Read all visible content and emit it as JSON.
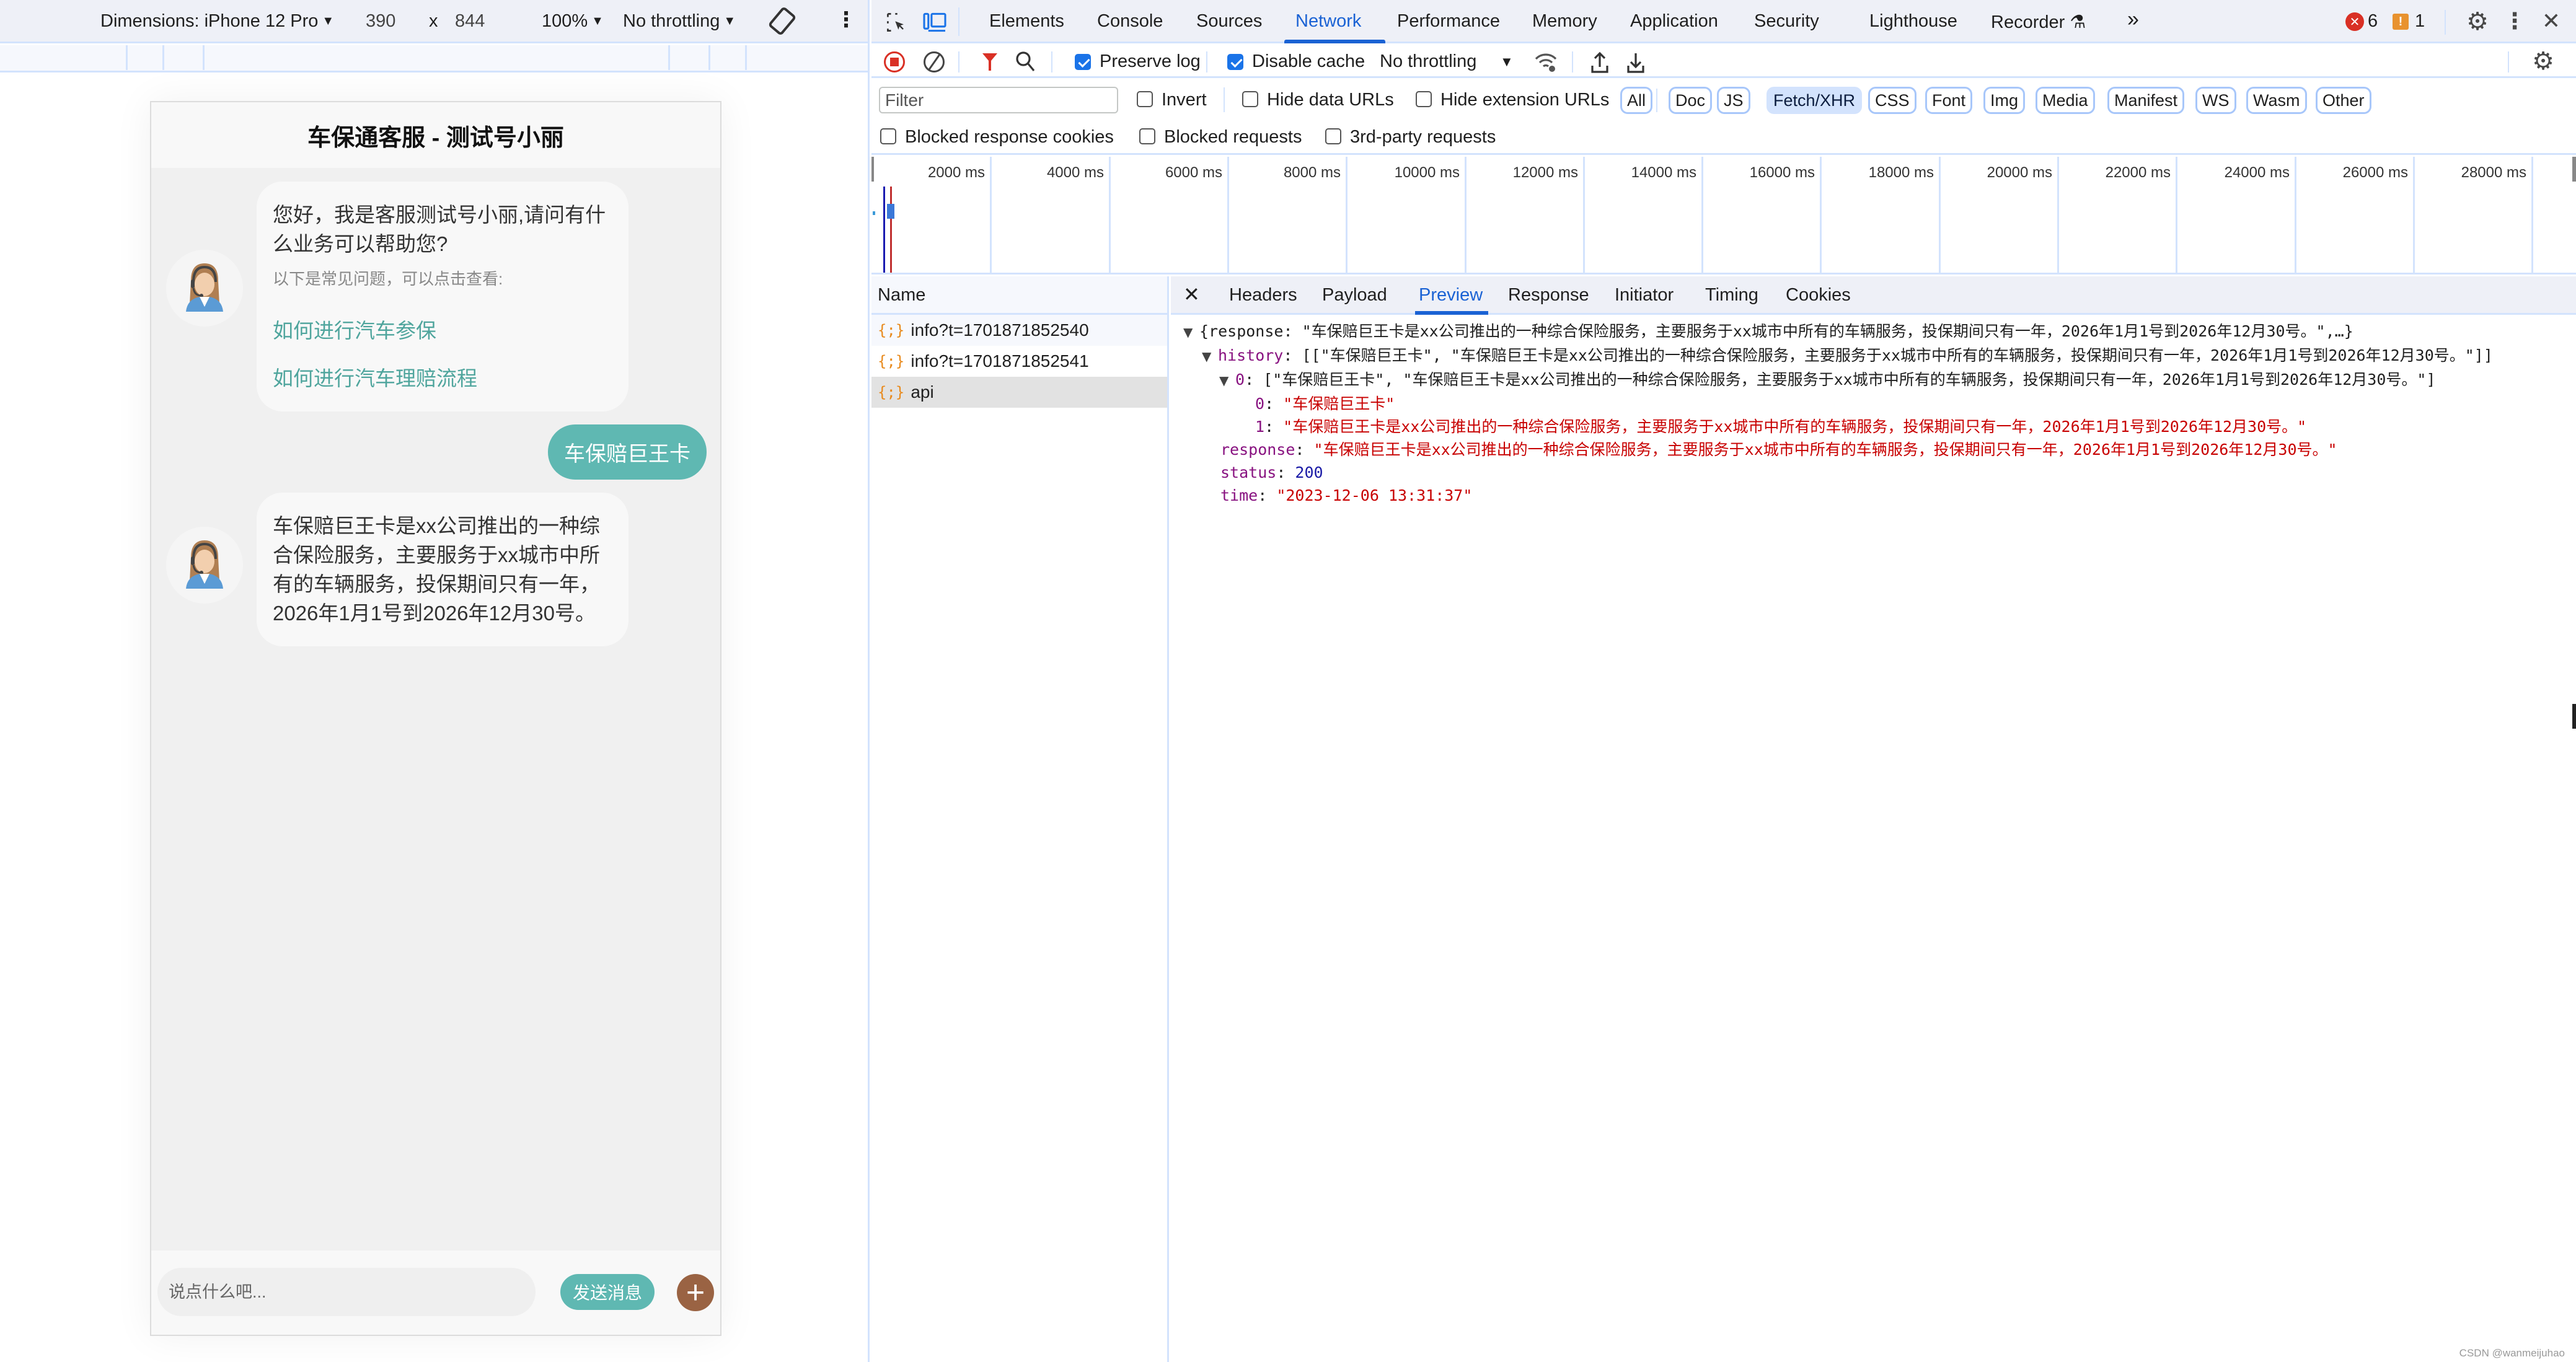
{
  "device_toolbar": {
    "dimensions_label": "Dimensions: iPhone 12 Pro",
    "width": "390",
    "times": "x",
    "height": "844",
    "zoom": "100%",
    "throttling": "No throttling"
  },
  "chat": {
    "title": "车保通客服 - 测试号小丽",
    "messages": [
      {
        "from": "agent",
        "text": "您好，我是客服测试号小丽,请问有什么业务可以帮助您?",
        "hint": "以下是常见问题，可以点击查看:",
        "faq": [
          "如何进行汽车参保",
          "如何进行汽车理赔流程"
        ]
      },
      {
        "from": "user",
        "text": "车保赔巨王卡"
      },
      {
        "from": "agent",
        "text": "车保赔巨王卡是xx公司推出的一种综合保险服务，主要服务于xx城市中所有的车辆服务，投保期间只有一年，2026年1月1号到2026年12月30号。"
      }
    ],
    "input_placeholder": "说点什么吧...",
    "send_label": "发送消息",
    "plus_label": "+"
  },
  "devtools": {
    "tabs": [
      "Elements",
      "Console",
      "Sources",
      "Network",
      "Performance",
      "Memory",
      "Application",
      "Security",
      "Lighthouse",
      "Recorder"
    ],
    "active_tab": "Network",
    "more_tabs": "»",
    "error_count": "6",
    "warning_count": "1",
    "toolbar": {
      "preserve_log": "Preserve log",
      "preserve_log_checked": true,
      "disable_cache": "Disable cache",
      "disable_cache_checked": true,
      "throttling": "No throttling"
    },
    "filter": {
      "placeholder": "Filter",
      "invert": "Invert",
      "hide_data_urls": "Hide data URLs",
      "hide_extension_urls": "Hide extension URLs",
      "types": [
        "All",
        "Doc",
        "JS",
        "Fetch/XHR",
        "CSS",
        "Font",
        "Img",
        "Media",
        "Manifest",
        "WS",
        "Wasm",
        "Other"
      ],
      "active_type": "Fetch/XHR",
      "blocked_response_cookies": "Blocked response cookies",
      "blocked_requests": "Blocked requests",
      "third_party": "3rd-party requests"
    },
    "overview_ticks": [
      "2000 ms",
      "4000 ms",
      "6000 ms",
      "8000 ms",
      "10000 ms",
      "12000 ms",
      "14000 ms",
      "16000 ms",
      "18000 ms",
      "20000 ms",
      "22000 ms",
      "24000 ms",
      "26000 ms",
      "28000 ms"
    ],
    "requests_header": "Name",
    "requests": [
      {
        "name": "info?t=1701871852540"
      },
      {
        "name": "info?t=1701871852541"
      },
      {
        "name": "api",
        "selected": true
      }
    ],
    "detail_tabs": [
      "Headers",
      "Payload",
      "Preview",
      "Response",
      "Initiator",
      "Timing",
      "Cookies"
    ],
    "active_detail_tab": "Preview",
    "preview": {
      "root_summary": "{response: \"车保赔巨王卡是xx公司推出的一种综合保险服务，主要服务于xx城市中所有的车辆服务，投保期间只有一年，2026年1月1号到2026年12月30号。\",…}",
      "history_key": "history",
      "history_summary": "[[\"车保赔巨王卡\", \"车保赔巨王卡是xx公司推出的一种综合保险服务，主要服务于xx城市中所有的车辆服务，投保期间只有一年，2026年1月1号到2026年12月30号。\"]]",
      "history0_key": "0",
      "history0_summary": "[\"车保赔巨王卡\", \"车保赔巨王卡是xx公司推出的一种综合保险服务，主要服务于xx城市中所有的车辆服务，投保期间只有一年，2026年1月1号到2026年12月30号。\"]",
      "item0_key": "0",
      "item0_value": "\"车保赔巨王卡\"",
      "item1_key": "1",
      "item1_value": "\"车保赔巨王卡是xx公司推出的一种综合保险服务，主要服务于xx城市中所有的车辆服务，投保期间只有一年，2026年1月1号到2026年12月30号。\"",
      "response_key": "response",
      "response_value": "\"车保赔巨王卡是xx公司推出的一种综合保险服务，主要服务于xx城市中所有的车辆服务，投保期间只有一年，2026年1月1号到2026年12月30号。\"",
      "status_key": "status",
      "status_value": "200",
      "time_key": "time",
      "time_value": "\"2023-12-06 13:31:37\""
    }
  },
  "watermark": "CSDN @wanmeijuhao"
}
